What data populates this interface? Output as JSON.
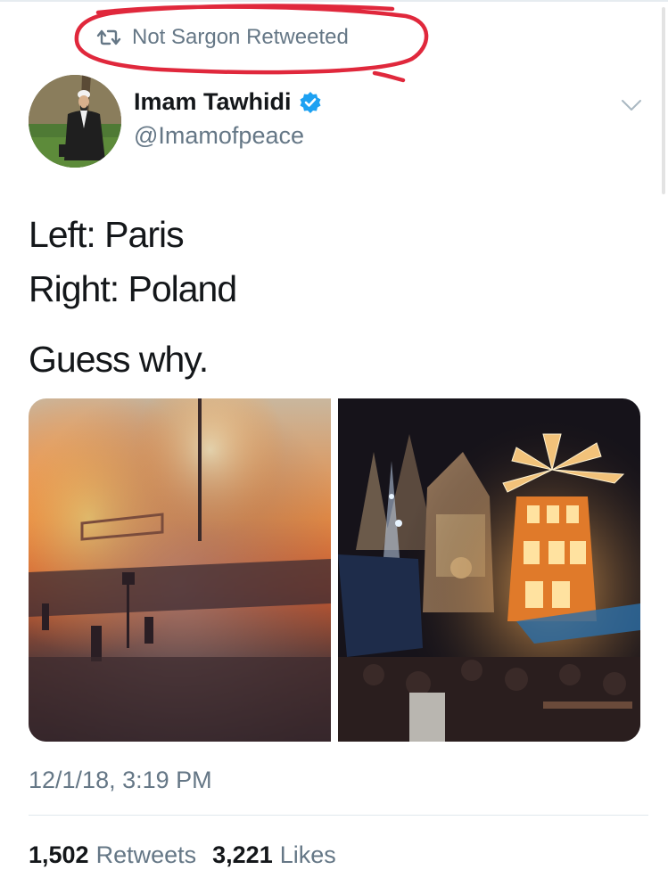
{
  "retweet_context": {
    "text": "Not Sargon Retweeted"
  },
  "author": {
    "display_name": "Imam Tawhidi",
    "handle": "@Imamofpeace",
    "verified": true
  },
  "tweet": {
    "lines": [
      "Left: Paris",
      "Right: Poland",
      "Guess why."
    ],
    "timestamp": "12/1/18, 3:19 PM"
  },
  "media": {
    "left_photo": "fire-and-smoke-street-photo",
    "right_photo": "christmas-market-night-photo"
  },
  "stats": {
    "retweets_count": "1,502",
    "retweets_label": "Retweets",
    "likes_count": "3,221",
    "likes_label": "Likes"
  },
  "colors": {
    "text": "#14171a",
    "muted": "#657786",
    "verified": "#1da1f2",
    "annotation_red": "#e0283c"
  }
}
